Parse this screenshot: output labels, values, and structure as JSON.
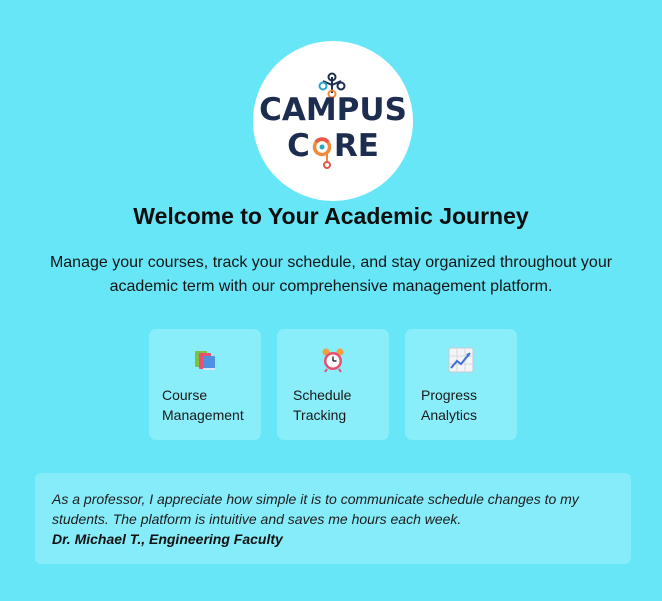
{
  "brand": {
    "line1": "CAMPUS",
    "line2_prefix": "C",
    "line2_suffix": "RE",
    "colors": {
      "navy": "#1d2d50",
      "orange": "#f08a3c",
      "teal": "#2aa6c2",
      "red": "#e4574c"
    }
  },
  "hero": {
    "title": "Welcome to Your Academic Journey",
    "subtitle": "Manage your courses, track your schedule, and stay organized throughout your academic term with our comprehensive management platform."
  },
  "features": [
    {
      "icon": "books-icon",
      "line1": "Course",
      "line2": "Management"
    },
    {
      "icon": "alarm-clock-icon",
      "line1": "Schedule",
      "line2": "Tracking"
    },
    {
      "icon": "chart-increasing-icon",
      "line1": "Progress",
      "line2": "Analytics"
    }
  ],
  "testimonial": {
    "quote": "As a professor, I appreciate how simple it is to communicate schedule changes to my students. The platform is intuitive and saves me hours each week.",
    "author": "Dr. Michael T., Engineering Faculty"
  },
  "colors": {
    "background": "#66e6f7",
    "card": "#89edfa"
  }
}
